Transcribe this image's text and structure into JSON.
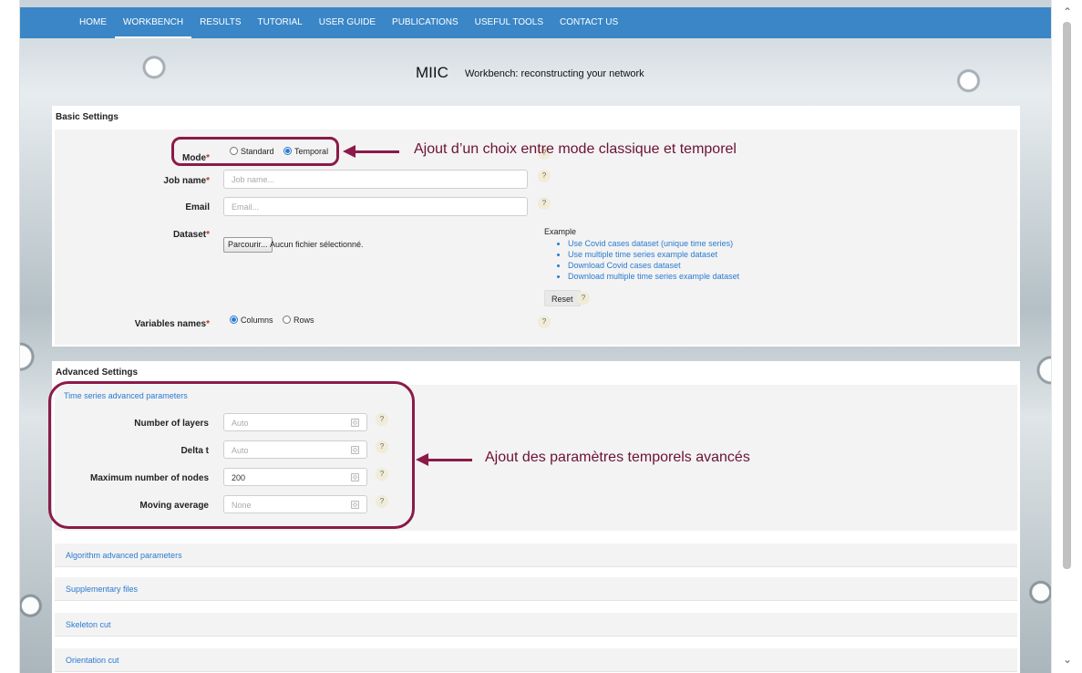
{
  "nav": {
    "items": [
      "HOME",
      "WORKBENCH",
      "RESULTS",
      "TUTORIAL",
      "USER GUIDE",
      "PUBLICATIONS",
      "USEFUL TOOLS",
      "CONTACT US"
    ],
    "active": "WORKBENCH"
  },
  "banner": {
    "title": "MIIC",
    "subtitle": "Workbench: reconstructing your network"
  },
  "basic": {
    "header": "Basic Settings",
    "mode": {
      "label": "Mode",
      "options": [
        "Standard",
        "Temporal"
      ],
      "selected": "Temporal"
    },
    "job_name": {
      "label": "Job name",
      "placeholder": "Job name..."
    },
    "email": {
      "label": "Email",
      "placeholder": "Email..."
    },
    "dataset": {
      "label": "Dataset",
      "button": "Parcourir...",
      "file_status": "Aucun fichier sélectionné."
    },
    "example": {
      "title": "Example",
      "links": [
        "Use Covid cases dataset (unique time series)",
        "Use multiple time series example dataset",
        "Download Covid cases dataset",
        "Download multiple time series example dataset"
      ],
      "reset": "Reset"
    },
    "variables_names": {
      "label": "Variables names",
      "options": [
        "Columns",
        "Rows"
      ],
      "selected": "Columns"
    },
    "help_glyph": "?"
  },
  "advanced": {
    "header": "Advanced Settings",
    "time_series": {
      "title": "Time series advanced parameters",
      "fields": [
        {
          "label": "Number of layers",
          "value": "Auto"
        },
        {
          "label": "Delta t",
          "value": "Auto"
        },
        {
          "label": "Maximum number of nodes",
          "value": "200"
        },
        {
          "label": "Moving average",
          "value": "None"
        }
      ]
    },
    "sections": [
      "Algorithm advanced parameters",
      "Supplementary files",
      "Skeleton cut",
      "Orientation cut"
    ]
  },
  "annotations": {
    "mode_note": "Ajout d’un choix entre mode classique et temporel",
    "temporal_note": "Ajout des paramètres temporels avancés"
  },
  "colors": {
    "navbar": "#3a86c7",
    "link": "#2a7bd0",
    "annotation": "#8b1a48"
  }
}
